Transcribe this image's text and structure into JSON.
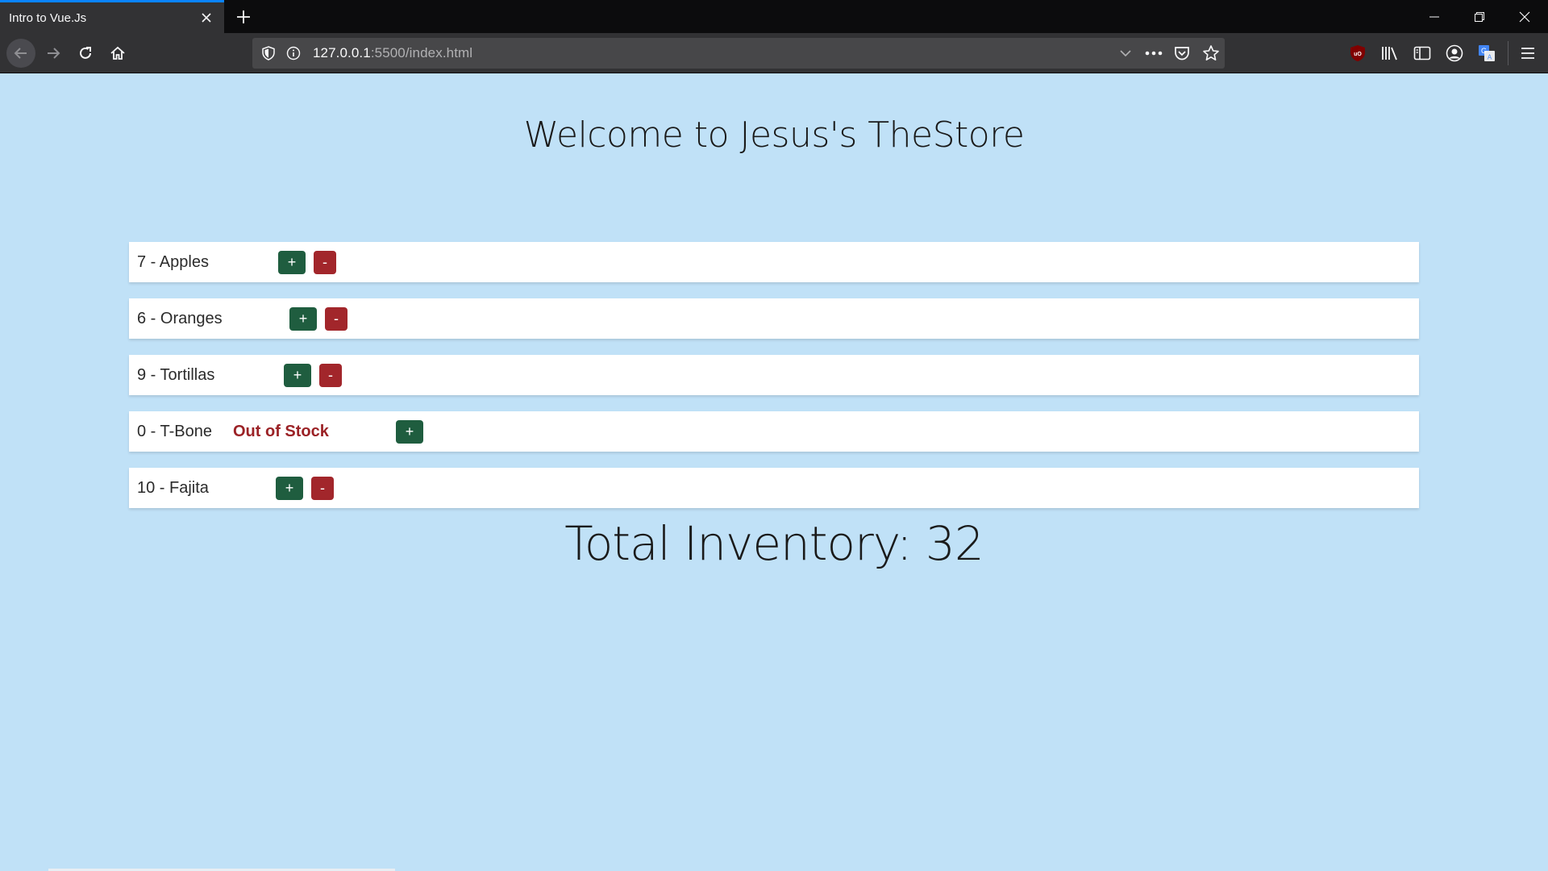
{
  "browser": {
    "tab_title": "Intro to Vue.Js",
    "url_host": "127.0.0.1",
    "url_path": ":5500/index.html",
    "accent_color": "#0a84ff",
    "icons": [
      "back-icon",
      "forward-icon",
      "reload-icon",
      "home-icon",
      "shield-icon",
      "info-icon",
      "dropdown-icon",
      "more-icon",
      "pocket-icon",
      "star-icon",
      "ublock-icon",
      "library-icon",
      "sidebar-icon",
      "account-icon",
      "translate-icon",
      "menu-icon"
    ]
  },
  "page": {
    "heading": "Welcome to Jesus's TheStore",
    "background_color": "#c0e1f7",
    "items": [
      {
        "label": "7 - Apples",
        "quantity": 7,
        "name": "Apples",
        "out_of_stock": false
      },
      {
        "label": "6 - Oranges",
        "quantity": 6,
        "name": "Oranges",
        "out_of_stock": false
      },
      {
        "label": "9 - Tortillas",
        "quantity": 9,
        "name": "Tortillas",
        "out_of_stock": false
      },
      {
        "label": "0 - T-Bone",
        "quantity": 0,
        "name": "T-Bone",
        "out_of_stock": true,
        "stock_text": "Out of Stock"
      },
      {
        "label": "10 - Fajita",
        "quantity": 10,
        "name": "Fajita",
        "out_of_stock": false
      }
    ],
    "plus_label": "+",
    "minus_label": "-",
    "plus_color": "#1f5d3f",
    "minus_color": "#a2262b",
    "total_text": "Total Inventory: 32"
  }
}
